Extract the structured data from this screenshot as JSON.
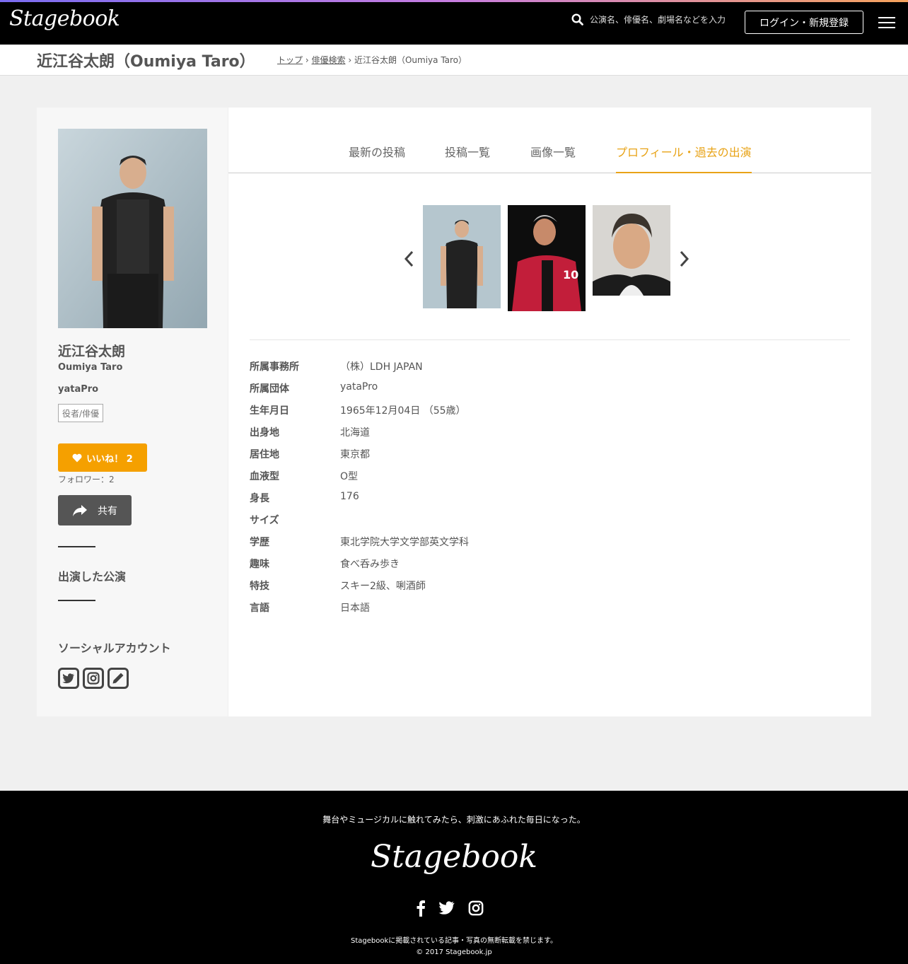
{
  "header": {
    "logo": "Stagebook",
    "search_placeholder": "公演名、俳優名、劇場名などを入力",
    "login_label": "ログイン・新規登録"
  },
  "title_bar": {
    "page_title": "近江谷太朗（Oumiya Taro）",
    "breadcrumb": {
      "top": "トップ",
      "search": "俳優検索",
      "current": "近江谷太朗（Oumiya Taro）",
      "separator": "›"
    }
  },
  "sidebar": {
    "name_ja": "近江谷太朗",
    "name_en": "Oumiya Taro",
    "group": "yataPro",
    "tag": "役者/俳優",
    "like_label": "いいね！ 2",
    "followers": "フォロワー：2",
    "share_label": "共有",
    "performances_heading": "出演した公演",
    "social_heading": "ソーシャルアカウント"
  },
  "tabs": [
    {
      "label": "最新の投稿",
      "active": false
    },
    {
      "label": "投稿一覧",
      "active": false
    },
    {
      "label": "画像一覧",
      "active": false
    },
    {
      "label": "プロフィール・過去の出演",
      "active": true
    }
  ],
  "profile": [
    {
      "key": "所属事務所",
      "value": "（株）LDH JAPAN"
    },
    {
      "key": "所属団体",
      "value": "yataPro"
    },
    {
      "key": "生年月日",
      "value": "1965年12月04日 （55歳）"
    },
    {
      "key": "出身地",
      "value": "北海道"
    },
    {
      "key": "居住地",
      "value": "東京都"
    },
    {
      "key": "血液型",
      "value": "O型"
    },
    {
      "key": "身長",
      "value": "176"
    },
    {
      "key": "サイズ",
      "value": ""
    },
    {
      "key": "学歴",
      "value": "東北学院大学文学部英文学科"
    },
    {
      "key": "趣味",
      "value": "食べ呑み歩き"
    },
    {
      "key": "特技",
      "value": "スキー2級、唎酒師"
    },
    {
      "key": "言語",
      "value": "日本語"
    }
  ],
  "footer": {
    "tagline": "舞台やミュージカルに触れてみたら、刺激にあふれた毎日になった。",
    "logo": "Stagebook",
    "notice": "Stagebookに掲載されている記事・写真の無断転載を禁じます。",
    "copyright": "© 2017 Stagebook.jp"
  },
  "colors": {
    "accent": "#e8a317",
    "like": "#f5a000",
    "share": "#555555"
  }
}
